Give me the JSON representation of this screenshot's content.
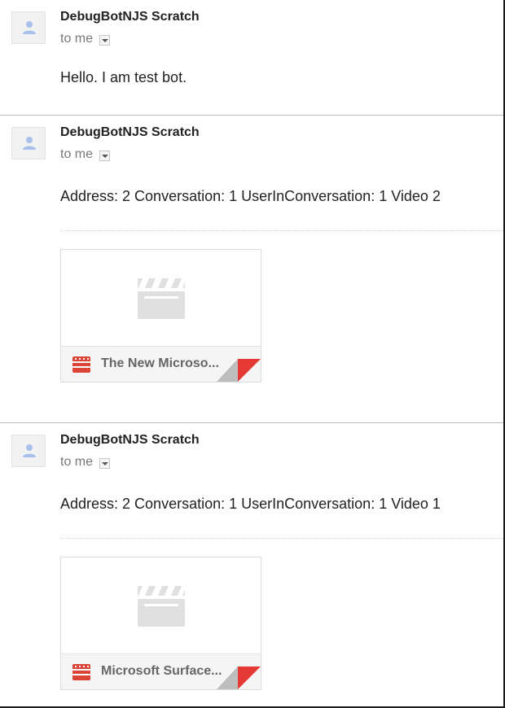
{
  "messages": [
    {
      "sender": "DebugBotNJS Scratch",
      "recipient": "to me",
      "body": "Hello. I am test bot."
    },
    {
      "sender": "DebugBotNJS Scratch",
      "recipient": "to me",
      "body": "Address: 2 Conversation: 1 UserInConversation: 1 Video 2",
      "attachment": {
        "name": "The New Microso...",
        "icon": "film-icon",
        "preview_icon": "clapperboard-icon"
      }
    },
    {
      "sender": "DebugBotNJS Scratch",
      "recipient": "to me",
      "body": "Address: 2 Conversation: 1 UserInConversation: 1 Video 1",
      "attachment": {
        "name": "Microsoft Surface...",
        "icon": "film-icon",
        "preview_icon": "clapperboard-icon"
      }
    }
  ],
  "colors": {
    "avatar_figure": "#a9c1ea",
    "file_icon": "#db4437",
    "corner_fold_red": "#e53935",
    "corner_fold_grey": "#bdbdbd",
    "clapper_grey": "#e0e0e0"
  }
}
